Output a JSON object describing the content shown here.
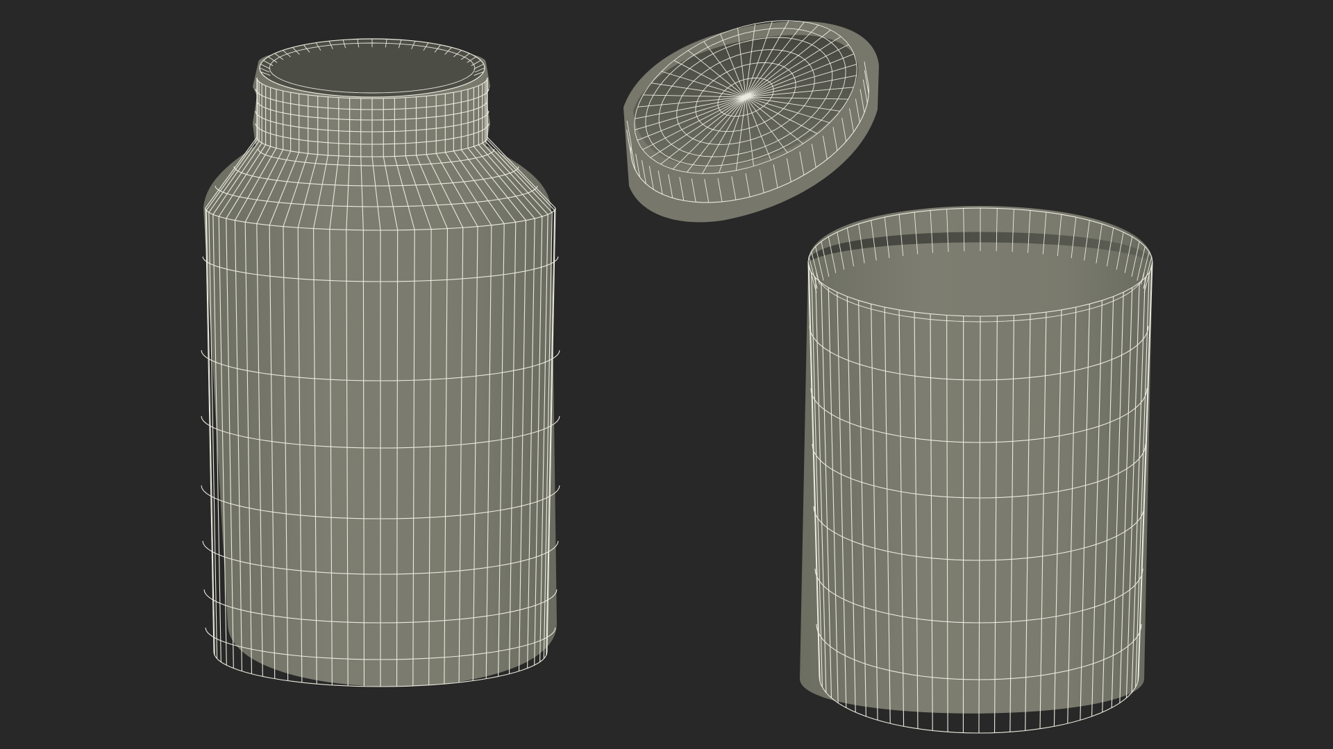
{
  "scene": {
    "background_color": "#282828",
    "surface_color": "#7b7c6f",
    "surface_shadow_color": "#5c5d52",
    "inner_surface_color": "#4f5047",
    "wire_color": "#ecebe0",
    "objects": [
      {
        "name": "bottle-body",
        "shape": "cylinder",
        "vertical_segments": 32
      },
      {
        "name": "bottle-cap",
        "shape": "disc-cap",
        "radial_segments": 40
      },
      {
        "name": "bottle-label-sleeve",
        "shape": "open-cylinder",
        "vertical_segments": 32
      }
    ]
  }
}
